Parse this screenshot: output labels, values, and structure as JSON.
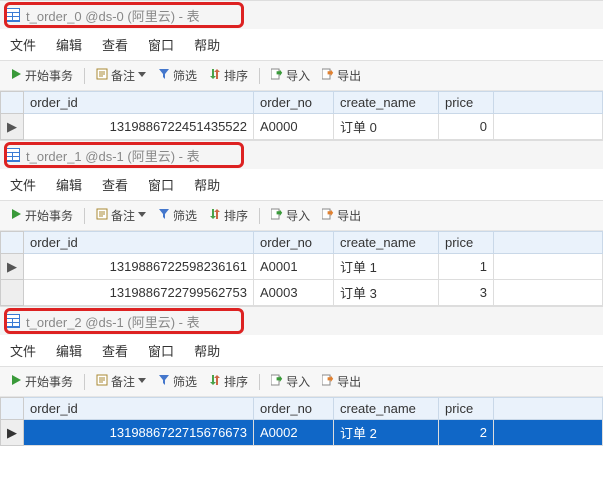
{
  "menus": {
    "file": "文件",
    "edit": "编辑",
    "view": "查看",
    "window": "窗口",
    "help": "帮助"
  },
  "toolbar": {
    "begin_tx": "开始事务",
    "memo": "备注",
    "filter": "筛选",
    "sort": "排序",
    "import": "导入",
    "export": "导出"
  },
  "columns": {
    "order_id": "order_id",
    "order_no": "order_no",
    "create_name": "create_name",
    "price": "price"
  },
  "panels": [
    {
      "title": "t_order_0 @ds-0 (阿里云) - 表",
      "red_width": 240,
      "rows": [
        {
          "order_id": "1319886722451435522",
          "order_no": "A0000",
          "create_name": "订单 0",
          "price": "0",
          "selected": false,
          "current": true
        }
      ]
    },
    {
      "title": "t_order_1 @ds-1 (阿里云) - 表",
      "red_width": 240,
      "rows": [
        {
          "order_id": "1319886722598236161",
          "order_no": "A0001",
          "create_name": "订单 1",
          "price": "1",
          "selected": false,
          "current": true
        },
        {
          "order_id": "1319886722799562753",
          "order_no": "A0003",
          "create_name": "订单 3",
          "price": "3",
          "selected": false,
          "current": false
        }
      ]
    },
    {
      "title": "t_order_2 @ds-1 (阿里云) - 表",
      "red_width": 240,
      "rows": [
        {
          "order_id": "1319886722715676673",
          "order_no": "A0002",
          "create_name": "订单 2",
          "price": "2",
          "selected": true,
          "current": true
        }
      ]
    }
  ]
}
